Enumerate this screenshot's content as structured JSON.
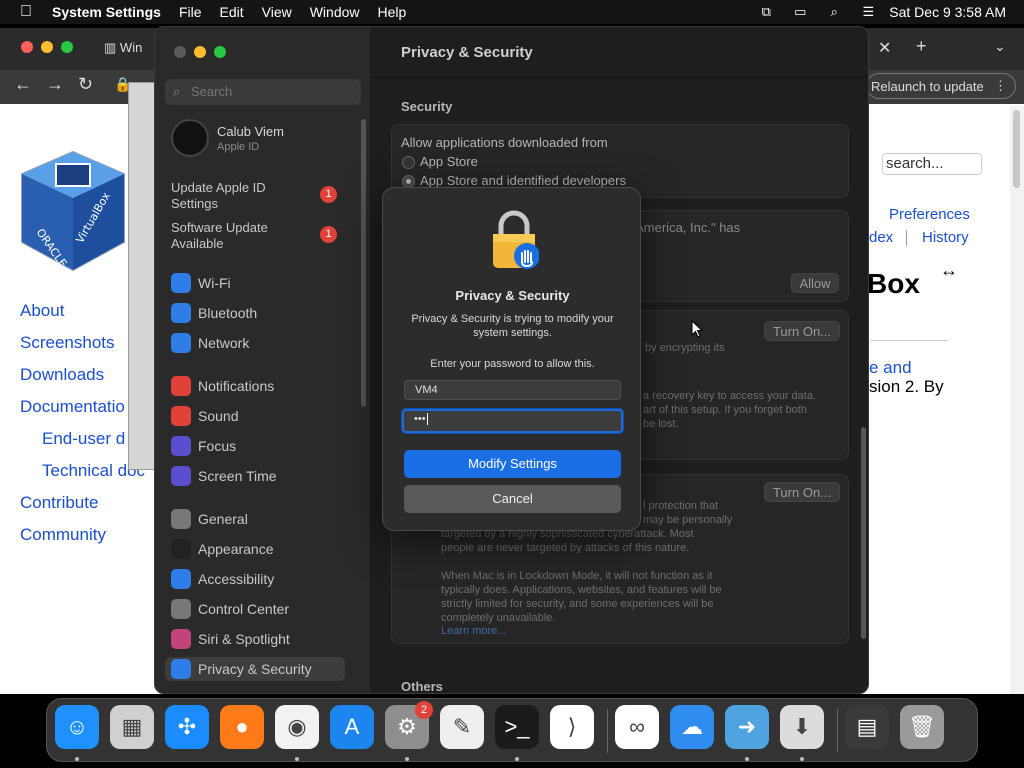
{
  "menubar": {
    "app_name": "System Settings",
    "menus": [
      "File",
      "Edit",
      "View",
      "Window",
      "Help"
    ],
    "clock": "Sat Dec 9  3:58 AM",
    "status_icons": [
      "screen-mirroring-icon",
      "window-icon",
      "search-icon",
      "control-center-icon"
    ]
  },
  "browser": {
    "tab_title_partial": "Win",
    "relaunch_label": "Relaunch to update",
    "search_value": "search...",
    "header_links": [
      "Preferences",
      "dex",
      "History"
    ],
    "heading_partial": "Box",
    "body_lines": [
      "e and",
      "sion 2. By"
    ],
    "nav": [
      "About",
      "Screenshots",
      "Downloads",
      "Documentatio",
      "End-user d",
      "Technical doc",
      "Contribute",
      "Community"
    ],
    "resize_glyph": "↔"
  },
  "sidebar": {
    "search_placeholder": "Search",
    "user_name": "Calub Viem",
    "user_sub": "Apple ID",
    "updates": [
      {
        "label_line1": "Update Apple ID",
        "label_line2": "Settings",
        "badge": "1"
      },
      {
        "label_line1": "Software Update",
        "label_line2": "Available",
        "badge": "1"
      }
    ],
    "group1": [
      {
        "label": "Wi-Fi",
        "icon": "wifi-icon",
        "color": "#2f7ee8"
      },
      {
        "label": "Bluetooth",
        "icon": "bluetooth-icon",
        "color": "#2f7ee8"
      },
      {
        "label": "Network",
        "icon": "globe-icon",
        "color": "#2f7ee8"
      }
    ],
    "group2": [
      {
        "label": "Notifications",
        "icon": "bell-icon",
        "color": "#e0423a"
      },
      {
        "label": "Sound",
        "icon": "speaker-icon",
        "color": "#e0423a"
      },
      {
        "label": "Focus",
        "icon": "moon-icon",
        "color": "#5a4fcf"
      },
      {
        "label": "Screen Time",
        "icon": "hourglass-icon",
        "color": "#5a4fcf"
      }
    ],
    "group3": [
      {
        "label": "General",
        "icon": "gear-icon",
        "color": "#777777"
      },
      {
        "label": "Appearance",
        "icon": "appearance-icon",
        "color": "#222222"
      },
      {
        "label": "Accessibility",
        "icon": "accessibility-icon",
        "color": "#2f7ee8"
      },
      {
        "label": "Control Center",
        "icon": "control-center-icon",
        "color": "#777777"
      },
      {
        "label": "Siri & Spotlight",
        "icon": "siri-icon",
        "color": "#c1447a"
      },
      {
        "label": "Privacy & Security",
        "icon": "hand-icon",
        "color": "#2f7ee8",
        "selected": true
      }
    ]
  },
  "content": {
    "title": "Privacy & Security",
    "security_heading": "Security",
    "allow_label": "Allow applications downloaded from",
    "options": [
      {
        "label": "App Store",
        "selected": false
      },
      {
        "label": "App Store and identified developers",
        "selected": true
      }
    ],
    "blocked_text_partial": "e America, Inc.\" has",
    "allow_button": "Allow",
    "filevault_button": "Turn On...",
    "filevault_partial": "by encrypting its",
    "recovery_line1": "a recovery key to access your data.",
    "recovery_line2": "art of this setup. If you forget both",
    "recovery_line3": "be lost.",
    "lockdown_button": "Turn On...",
    "lockdown_line1": "l protection that",
    "lockdown_line2": "may be personally",
    "lockdown_line3": "targeted by a highly sophisticated cyberattack. Most",
    "lockdown_line4": "people are never targeted by attacks of this nature.",
    "lockdown_para2": [
      "When Mac is in Lockdown Mode, it will not function as it",
      "typically does. Applications, websites, and features will be",
      "strictly limited for security, and some experiences will be",
      "completely unavailable."
    ],
    "learn_more": "Learn more...",
    "others_heading": "Others"
  },
  "dialog": {
    "title": "Privacy & Security",
    "message": "Privacy & Security is trying to modify your system settings.",
    "prompt": "Enter your password to allow this.",
    "username_value": "VM4",
    "password_mask": "•••",
    "primary_button": "Modify Settings",
    "cancel_button": "Cancel"
  },
  "dock": {
    "apps": [
      {
        "name": "finder-icon",
        "color": "#1e90ff",
        "glyph": "☺",
        "running": true
      },
      {
        "name": "launchpad-icon",
        "color": "#d0d0d0",
        "glyph": "▦",
        "running": false
      },
      {
        "name": "safari-icon",
        "color": "#1a8cff",
        "glyph": "✣",
        "running": false
      },
      {
        "name": "firefox-icon",
        "color": "#ff7a18",
        "glyph": "●",
        "running": false
      },
      {
        "name": "chrome-icon",
        "color": "#f2f2f2",
        "glyph": "◉",
        "running": true
      },
      {
        "name": "app-store-icon",
        "color": "#1c86ee",
        "glyph": "A",
        "running": false
      },
      {
        "name": "system-settings-icon",
        "color": "#8e8e8e",
        "glyph": "⚙",
        "running": true,
        "badge": "2"
      },
      {
        "name": "textedit-icon",
        "color": "#efefef",
        "glyph": "✎",
        "running": false
      },
      {
        "name": "terminal-icon",
        "color": "#1b1b1b",
        "glyph": ">_",
        "running": true
      },
      {
        "name": "vscode-icon",
        "color": "#ffffff",
        "glyph": "⟩",
        "running": false
      },
      {
        "name": "visual-studio-icon",
        "color": "#ffffff",
        "glyph": "∞",
        "running": false
      },
      {
        "name": "icloud-icon",
        "color": "#2f8cf0",
        "glyph": "☁",
        "running": false
      },
      {
        "name": "migration-icon",
        "color": "#4fa3e0",
        "glyph": "➜",
        "running": true
      },
      {
        "name": "installer-icon",
        "color": "#dcdcdc",
        "glyph": "⬇",
        "running": true
      },
      {
        "name": "downloads-icon",
        "color": "#3a3a3a",
        "glyph": "▤",
        "running": false
      },
      {
        "name": "trash-icon",
        "color": "#9a9a9a",
        "glyph": "🗑",
        "running": false
      }
    ]
  }
}
